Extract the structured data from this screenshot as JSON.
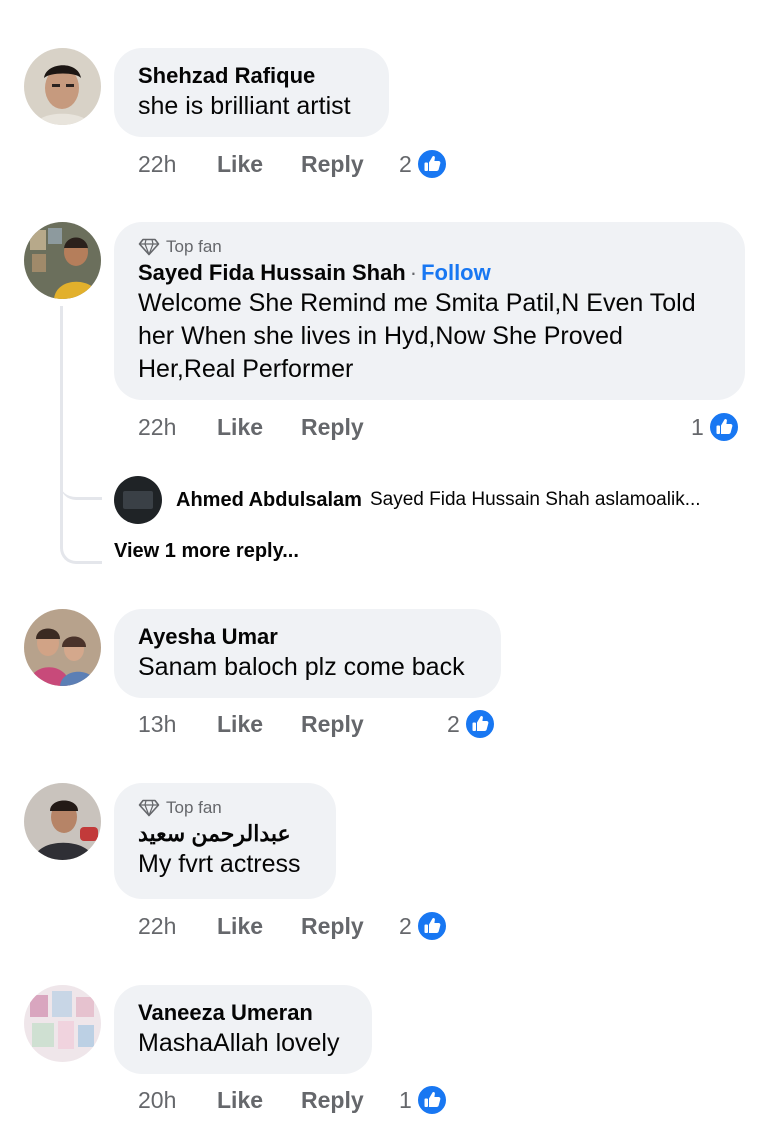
{
  "comments": [
    {
      "name": "Shehzad Rafique",
      "text": "she is brilliant artist",
      "time": "22h",
      "like": "Like",
      "reply": "Reply",
      "reactions": "2"
    },
    {
      "badge": "Top fan",
      "name": "Sayed Fida Hussain Shah",
      "follow": "Follow",
      "text": "Welcome She Remind me Smita Patil,N Even Told her When she lives in Hyd,Now She Proved Her,Real Performer",
      "time": "22h",
      "like": "Like",
      "reply": "Reply",
      "reactions": "1",
      "replies": [
        {
          "name": "Ahmed Abdulsalam",
          "text": "Sayed Fida Hussain Shah aslamoalik..."
        }
      ],
      "view_more": "View 1 more reply..."
    },
    {
      "name": "Ayesha Umar",
      "text": "Sanam baloch plz come back",
      "time": "13h",
      "like": "Like",
      "reply": "Reply",
      "reactions": "2"
    },
    {
      "badge": "Top fan",
      "name": "عبدالرحمن سعيد",
      "text": "My fvrt actress",
      "time": "22h",
      "like": "Like",
      "reply": "Reply",
      "reactions": "2"
    },
    {
      "name": "Vaneeza Umeran",
      "text": "MashaAllah lovely",
      "time": "20h",
      "like": "Like",
      "reply": "Reply",
      "reactions": "1"
    }
  ],
  "colors": {
    "bubble": "#f0f2f5",
    "link": "#1877f2",
    "meta": "#65676b",
    "like_blue": "#1877f2"
  }
}
